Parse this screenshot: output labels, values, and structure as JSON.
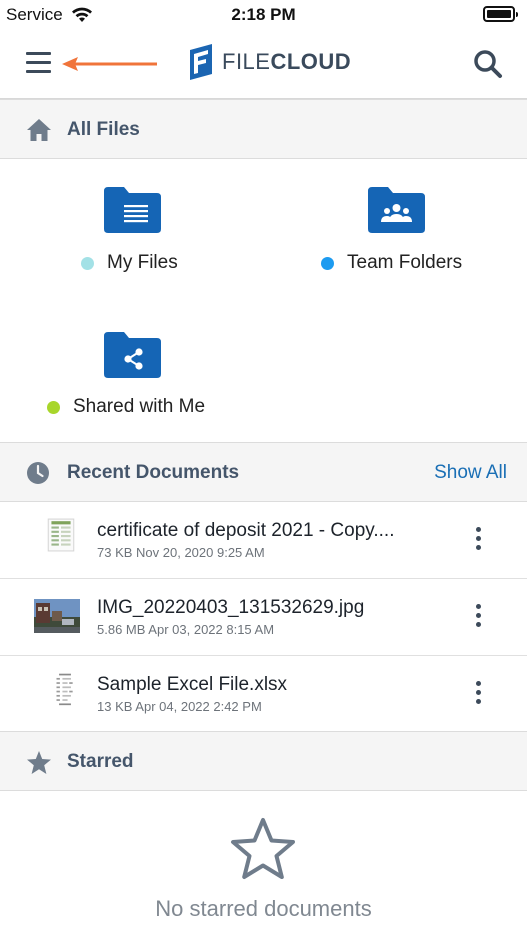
{
  "status": {
    "carrier": "Service",
    "time": "2:18 PM"
  },
  "header": {
    "logo_light": "FILE",
    "logo_bold": "CLOUD"
  },
  "all_files": {
    "title": "All Files",
    "folders": [
      {
        "label": "My Files",
        "dot_color": "#a3e1e6",
        "icon": "document-lines-icon"
      },
      {
        "label": "Team Folders",
        "dot_color": "#1d9bf0",
        "icon": "people-icon"
      },
      {
        "label": "Shared with Me",
        "dot_color": "#a8d62b",
        "icon": "share-icon"
      }
    ]
  },
  "recent": {
    "title": "Recent Documents",
    "show_all": "Show All",
    "docs": [
      {
        "name": "certificate of deposit 2021 - Copy....",
        "meta": "73 KB Nov 20, 2020 9:25 AM"
      },
      {
        "name": "IMG_20220403_131532629.jpg",
        "meta": "5.86 MB Apr 03, 2022 8:15 AM"
      },
      {
        "name": "Sample Excel File.xlsx",
        "meta": "13 KB Apr 04, 2022 2:42 PM"
      }
    ]
  },
  "starred": {
    "title": "Starred",
    "empty_text": "No starred documents"
  },
  "colors": {
    "folder_blue": "#1565b5",
    "header_text": "#45566b",
    "link_blue": "#1a6fb5",
    "annotation_orange": "#f0743a"
  }
}
